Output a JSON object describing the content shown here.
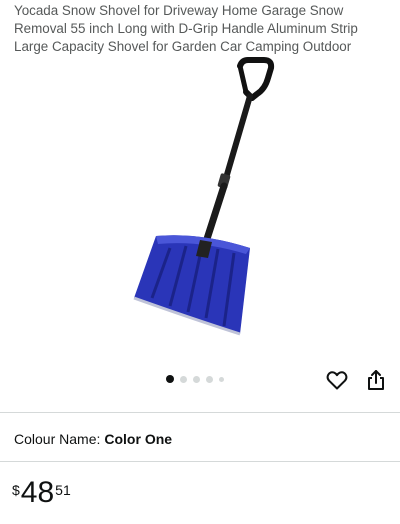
{
  "product": {
    "title": "Yocada Snow Shovel for Driveway Home Garage Snow Removal 55 inch Long with D-Grip Handle Aluminum Strip Large Capacity Shovel for Garden Car Camping Outdoor",
    "image": {
      "description_icon": "snow-shovel-image",
      "blade_color": "#2a35b8",
      "handle_color": "#111111"
    },
    "carousel": {
      "total": 5,
      "active_index": 0
    },
    "colour": {
      "label": "Colour Name:",
      "value": "Color One"
    },
    "price": {
      "symbol": "$",
      "whole": "48",
      "fraction": "51"
    }
  },
  "actions": {
    "wishlist_icon": "heart-icon",
    "share_icon": "share-icon"
  }
}
